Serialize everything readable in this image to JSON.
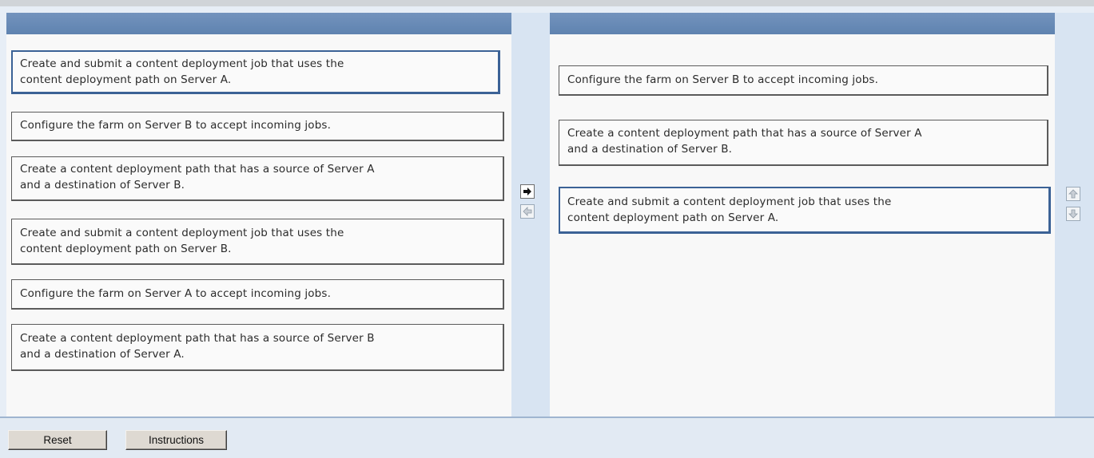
{
  "source_items": [
    {
      "lines": [
        "Create and submit a content deployment job that uses the",
        "content deployment path on Server A."
      ],
      "selected": true
    },
    {
      "lines": [
        "Configure the farm on Server B to accept incoming jobs."
      ],
      "selected": false
    },
    {
      "lines": [
        "Create a content deployment path that has a source of Server A",
        "and a destination of Server B."
      ],
      "selected": false
    },
    {
      "lines": [
        "Create and submit a content deployment job that uses the",
        "content deployment path on Server B."
      ],
      "selected": false
    },
    {
      "lines": [
        "Configure the farm on Server A to accept incoming jobs."
      ],
      "selected": false
    },
    {
      "lines": [
        "Create a content deployment path that has a source of Server B",
        "and a destination of Server A."
      ],
      "selected": false
    }
  ],
  "answer_items": [
    {
      "lines": [
        "Configure the farm on Server B to accept incoming jobs."
      ],
      "selected": false
    },
    {
      "lines": [
        "Create a content deployment path that has a source of Server A",
        "and a destination of Server B."
      ],
      "selected": false
    },
    {
      "lines": [
        "Create and submit a content deployment job that uses the",
        "content deployment path on Server A."
      ],
      "selected": true
    }
  ],
  "controls": {
    "move_right": {
      "icon": "arrow-right-icon",
      "enabled": true
    },
    "move_left": {
      "icon": "arrow-left-icon",
      "enabled": false
    },
    "move_up": {
      "icon": "arrow-up-icon",
      "enabled": false
    },
    "move_down": {
      "icon": "arrow-down-icon",
      "enabled": false
    }
  },
  "buttons": {
    "reset_label": "Reset",
    "instructions_label": "Instructions"
  },
  "colors": {
    "panel_header": "#6b8db7",
    "selected_border": "#3b6296",
    "gutter": "#d8e4f2"
  }
}
